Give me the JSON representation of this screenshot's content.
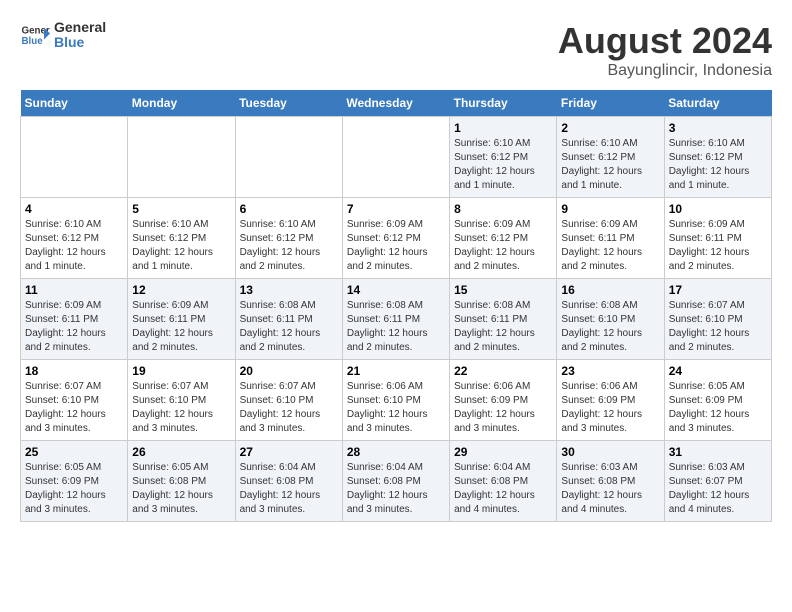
{
  "header": {
    "logo_line1": "General",
    "logo_line2": "Blue",
    "month_title": "August 2024",
    "location": "Bayunglincir, Indonesia"
  },
  "weekdays": [
    "Sunday",
    "Monday",
    "Tuesday",
    "Wednesday",
    "Thursday",
    "Friday",
    "Saturday"
  ],
  "weeks": [
    [
      {
        "day": "",
        "info": ""
      },
      {
        "day": "",
        "info": ""
      },
      {
        "day": "",
        "info": ""
      },
      {
        "day": "",
        "info": ""
      },
      {
        "day": "1",
        "info": "Sunrise: 6:10 AM\nSunset: 6:12 PM\nDaylight: 12 hours\nand 1 minute."
      },
      {
        "day": "2",
        "info": "Sunrise: 6:10 AM\nSunset: 6:12 PM\nDaylight: 12 hours\nand 1 minute."
      },
      {
        "day": "3",
        "info": "Sunrise: 6:10 AM\nSunset: 6:12 PM\nDaylight: 12 hours\nand 1 minute."
      }
    ],
    [
      {
        "day": "4",
        "info": "Sunrise: 6:10 AM\nSunset: 6:12 PM\nDaylight: 12 hours\nand 1 minute."
      },
      {
        "day": "5",
        "info": "Sunrise: 6:10 AM\nSunset: 6:12 PM\nDaylight: 12 hours\nand 1 minute."
      },
      {
        "day": "6",
        "info": "Sunrise: 6:10 AM\nSunset: 6:12 PM\nDaylight: 12 hours\nand 2 minutes."
      },
      {
        "day": "7",
        "info": "Sunrise: 6:09 AM\nSunset: 6:12 PM\nDaylight: 12 hours\nand 2 minutes."
      },
      {
        "day": "8",
        "info": "Sunrise: 6:09 AM\nSunset: 6:12 PM\nDaylight: 12 hours\nand 2 minutes."
      },
      {
        "day": "9",
        "info": "Sunrise: 6:09 AM\nSunset: 6:11 PM\nDaylight: 12 hours\nand 2 minutes."
      },
      {
        "day": "10",
        "info": "Sunrise: 6:09 AM\nSunset: 6:11 PM\nDaylight: 12 hours\nand 2 minutes."
      }
    ],
    [
      {
        "day": "11",
        "info": "Sunrise: 6:09 AM\nSunset: 6:11 PM\nDaylight: 12 hours\nand 2 minutes."
      },
      {
        "day": "12",
        "info": "Sunrise: 6:09 AM\nSunset: 6:11 PM\nDaylight: 12 hours\nand 2 minutes."
      },
      {
        "day": "13",
        "info": "Sunrise: 6:08 AM\nSunset: 6:11 PM\nDaylight: 12 hours\nand 2 minutes."
      },
      {
        "day": "14",
        "info": "Sunrise: 6:08 AM\nSunset: 6:11 PM\nDaylight: 12 hours\nand 2 minutes."
      },
      {
        "day": "15",
        "info": "Sunrise: 6:08 AM\nSunset: 6:11 PM\nDaylight: 12 hours\nand 2 minutes."
      },
      {
        "day": "16",
        "info": "Sunrise: 6:08 AM\nSunset: 6:10 PM\nDaylight: 12 hours\nand 2 minutes."
      },
      {
        "day": "17",
        "info": "Sunrise: 6:07 AM\nSunset: 6:10 PM\nDaylight: 12 hours\nand 2 minutes."
      }
    ],
    [
      {
        "day": "18",
        "info": "Sunrise: 6:07 AM\nSunset: 6:10 PM\nDaylight: 12 hours\nand 3 minutes."
      },
      {
        "day": "19",
        "info": "Sunrise: 6:07 AM\nSunset: 6:10 PM\nDaylight: 12 hours\nand 3 minutes."
      },
      {
        "day": "20",
        "info": "Sunrise: 6:07 AM\nSunset: 6:10 PM\nDaylight: 12 hours\nand 3 minutes."
      },
      {
        "day": "21",
        "info": "Sunrise: 6:06 AM\nSunset: 6:10 PM\nDaylight: 12 hours\nand 3 minutes."
      },
      {
        "day": "22",
        "info": "Sunrise: 6:06 AM\nSunset: 6:09 PM\nDaylight: 12 hours\nand 3 minutes."
      },
      {
        "day": "23",
        "info": "Sunrise: 6:06 AM\nSunset: 6:09 PM\nDaylight: 12 hours\nand 3 minutes."
      },
      {
        "day": "24",
        "info": "Sunrise: 6:05 AM\nSunset: 6:09 PM\nDaylight: 12 hours\nand 3 minutes."
      }
    ],
    [
      {
        "day": "25",
        "info": "Sunrise: 6:05 AM\nSunset: 6:09 PM\nDaylight: 12 hours\nand 3 minutes."
      },
      {
        "day": "26",
        "info": "Sunrise: 6:05 AM\nSunset: 6:08 PM\nDaylight: 12 hours\nand 3 minutes."
      },
      {
        "day": "27",
        "info": "Sunrise: 6:04 AM\nSunset: 6:08 PM\nDaylight: 12 hours\nand 3 minutes."
      },
      {
        "day": "28",
        "info": "Sunrise: 6:04 AM\nSunset: 6:08 PM\nDaylight: 12 hours\nand 3 minutes."
      },
      {
        "day": "29",
        "info": "Sunrise: 6:04 AM\nSunset: 6:08 PM\nDaylight: 12 hours\nand 4 minutes."
      },
      {
        "day": "30",
        "info": "Sunrise: 6:03 AM\nSunset: 6:08 PM\nDaylight: 12 hours\nand 4 minutes."
      },
      {
        "day": "31",
        "info": "Sunrise: 6:03 AM\nSunset: 6:07 PM\nDaylight: 12 hours\nand 4 minutes."
      }
    ]
  ]
}
